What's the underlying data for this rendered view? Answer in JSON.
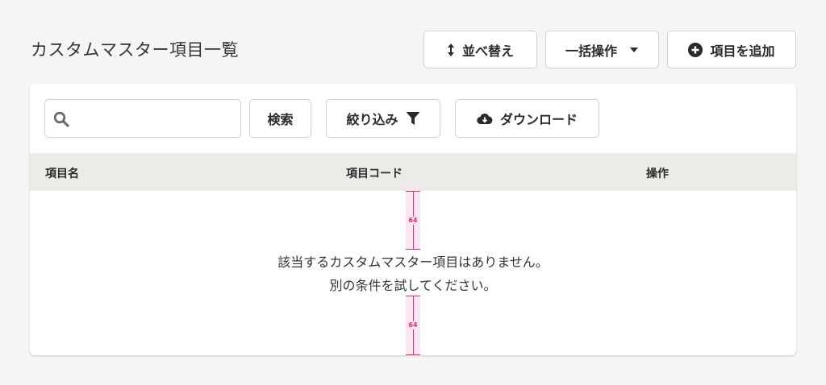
{
  "page": {
    "title": "カスタムマスター項目一覧"
  },
  "toolbar": {
    "sort_label": "並べ替え",
    "bulk_label": "一括操作",
    "add_label": "項目を追加"
  },
  "filters": {
    "search_placeholder": "",
    "search_button": "検索",
    "filter_label": "絞り込み",
    "download_label": "ダウンロード"
  },
  "table": {
    "columns": [
      "項目名",
      "項目コード",
      "操作"
    ],
    "rows": []
  },
  "empty_state": {
    "line1": "該当するカスタムマスター項目はありません。",
    "line2": "別の条件を試してください。"
  },
  "spacing_annotations": [
    "64",
    "64"
  ],
  "icons": {
    "sort": "sort-vertical-icon",
    "bulk": "caret-down-icon",
    "add": "plus-circle-icon",
    "search": "search-icon",
    "filter": "filter-icon",
    "download": "cloud-download-icon"
  },
  "colors": {
    "page_bg": "#f6f5f3",
    "header_bg": "#edebe7",
    "annotation": "#e0307a"
  }
}
